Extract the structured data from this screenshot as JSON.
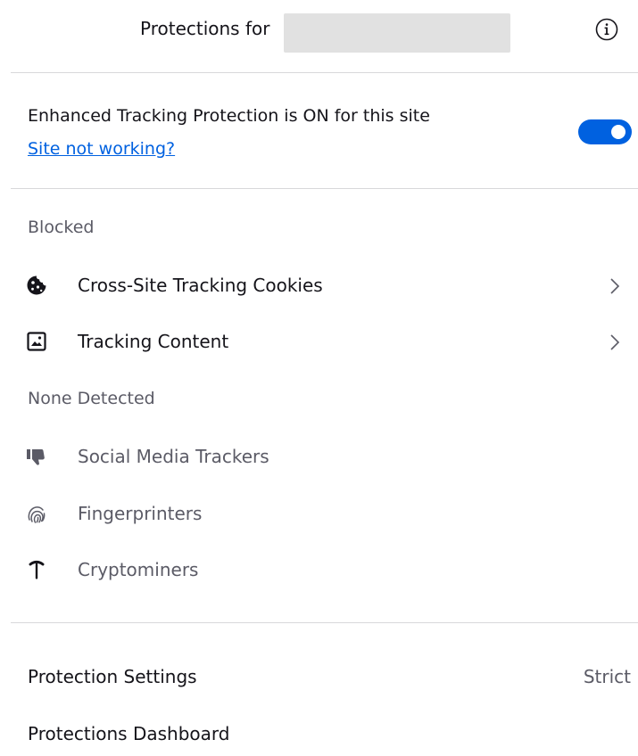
{
  "header": {
    "title": "Protections for",
    "info_icon": "info-icon"
  },
  "etp": {
    "status_text": "Enhanced Tracking Protection is ON for this site",
    "link_text": "Site not working?",
    "toggle_on": true,
    "toggle_color": "#0061e0"
  },
  "blocked": {
    "heading": "Blocked",
    "items": [
      {
        "label": "Cross-Site Tracking Cookies",
        "icon": "cookie-icon"
      },
      {
        "label": "Tracking Content",
        "icon": "image-icon"
      }
    ]
  },
  "none_detected": {
    "heading": "None Detected",
    "items": [
      {
        "label": "Social Media Trackers",
        "icon": "thumbs-down-icon"
      },
      {
        "label": "Fingerprinters",
        "icon": "fingerprint-icon"
      },
      {
        "label": "Cryptominers",
        "icon": "pickaxe-icon"
      }
    ]
  },
  "footer": {
    "settings_label": "Protection Settings",
    "settings_value": "Strict",
    "dashboard_label": "Protections Dashboard"
  }
}
